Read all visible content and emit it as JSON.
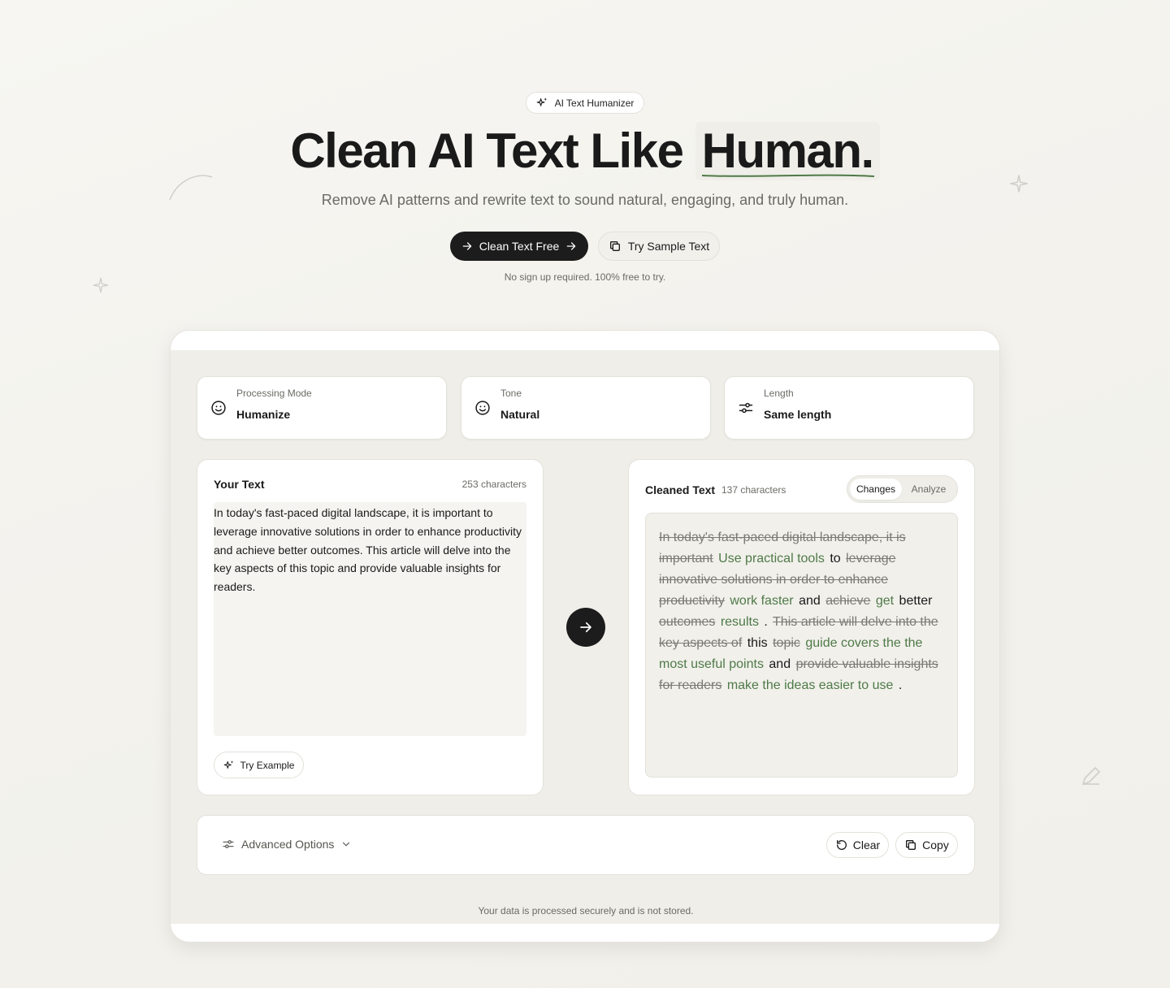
{
  "hero": {
    "badge_icon": "sparkles-icon",
    "badge_label": "AI Text Humanizer",
    "headline_main": "Clean AI Text Like",
    "headline_highlight": "Human.",
    "subtitle": "Remove AI patterns and rewrite text to sound natural, engaging, and truly human.",
    "primary_cta": "Clean Text Free",
    "secondary_cta": "Try Sample Text",
    "note": "No sign up required. 100% free to try."
  },
  "selectors": [
    {
      "icon": "smiley-icon",
      "label": "Processing Mode",
      "value": "Humanize"
    },
    {
      "icon": "smiley-icon",
      "label": "Tone",
      "value": "Natural"
    },
    {
      "icon": "sliders-icon",
      "label": "Length",
      "value": "Same length"
    }
  ],
  "input_panel": {
    "title": "Your Text",
    "count": "253 characters",
    "text": "In today's fast-paced digital landscape, it is important to leverage innovative solutions in order to enhance productivity and achieve better outcomes. This article will delve into the key aspects of this topic and provide valuable insights for readers.",
    "try_example": "Try Example"
  },
  "output_panel": {
    "title": "Cleaned Text",
    "count": "137 characters",
    "tabs": [
      "Changes",
      "Analyze"
    ],
    "active_tab": "Changes",
    "diff": [
      {
        "t": "del",
        "text": "In today's fast-paced digital landscape, it is important"
      },
      {
        "t": "ins",
        "text": "Use practical tools"
      },
      {
        "t": "kept",
        "text": "to"
      },
      {
        "t": "del",
        "text": "leverage innovative solutions in order to enhance productivity"
      },
      {
        "t": "ins",
        "text": "work faster"
      },
      {
        "t": "kept",
        "text": "and"
      },
      {
        "t": "del",
        "text": "achieve"
      },
      {
        "t": "ins",
        "text": "get"
      },
      {
        "t": "kept",
        "text": "better"
      },
      {
        "t": "del",
        "text": "outcomes"
      },
      {
        "t": "ins",
        "text": "results"
      },
      {
        "t": "kept",
        "text": "."
      },
      {
        "t": "del",
        "text": "This article will delve into the key aspects of"
      },
      {
        "t": "kept",
        "text": "this"
      },
      {
        "t": "del",
        "text": "topic"
      },
      {
        "t": "ins",
        "text": "guide covers the the most useful points"
      },
      {
        "t": "kept",
        "text": "and"
      },
      {
        "t": "del",
        "text": "provide valuable insights for readers"
      },
      {
        "t": "ins",
        "text": "make the ideas easier to use"
      },
      {
        "t": "kept",
        "text": "."
      }
    ]
  },
  "options": {
    "advanced_label": "Advanced Options",
    "clear_label": "Clear",
    "copy_label": "Copy"
  },
  "footer_note": "Your data is processed securely and is not stored.",
  "colors": {
    "accent_dark": "#1c1c1c",
    "inserted": "#4f7a48",
    "deleted": "#7a7a75",
    "background": "#f3f2ed"
  }
}
